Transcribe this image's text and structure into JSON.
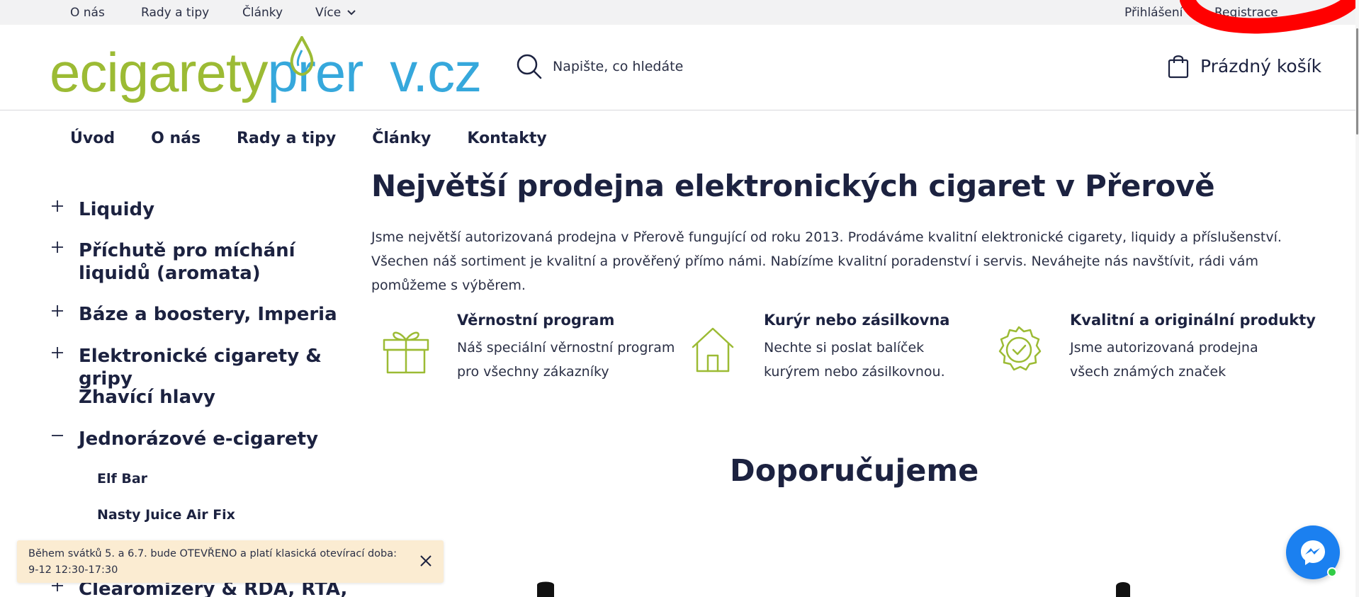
{
  "topbar": {
    "links": [
      "O nás",
      "Rady a tipy",
      "Články",
      "Více"
    ],
    "login": "Přihlášení",
    "register": "Registrace"
  },
  "header": {
    "logo_green": "ecigarety",
    "logo_pre": "prer",
    "logo_post": "v.cz",
    "search_placeholder": "Napište, co hledáte",
    "cart_label": "Prázdný košík"
  },
  "mainnav": [
    "Úvod",
    "O nás",
    "Rady a tipy",
    "Články",
    "Kontakty"
  ],
  "sidebar": {
    "categories": [
      {
        "label": "Liquidy",
        "state": "collapsed"
      },
      {
        "label": "Příchutě pro míchání liquidů (aromata)",
        "state": "collapsed"
      },
      {
        "label": "Báze a boostery, Imperia",
        "state": "collapsed"
      },
      {
        "label": "Elektronické cigarety & gripy",
        "state": "collapsed"
      },
      {
        "label": "Žhavící hlavy",
        "state": "none"
      },
      {
        "label": "Jednorázové e-cigarety",
        "state": "expanded"
      },
      {
        "label": "Clearomizery & RDA, RTA,",
        "state": "collapsed"
      }
    ],
    "subitems": [
      "Elf Bar",
      "Nasty Juice Air Fix"
    ]
  },
  "content": {
    "title": "Největší prodejna elektronických cigaret v Přerově",
    "intro": "Jsme největší autorizovaná prodejna v Přerově fungující od roku 2013. Prodáváme kvalitní elektronické cigarety, liquidy a příslušenství. Všechen náš sortiment je kvalitní a prověřený přímo námi. Nabízíme kvalitní poradenství i servis. Neváhejte nás navštívit, rádi vám pomůžeme s výběrem.",
    "features": [
      {
        "title": "Věrnostní program",
        "desc": "Náš speciální věrnostní program pro všechny zákazníky",
        "icon": "gift-icon"
      },
      {
        "title": "Kurýr nebo zásilkovna",
        "desc": "Nechte si poslat balíček kurýrem nebo zásilkovnou.",
        "icon": "house-icon"
      },
      {
        "title": "Kvalitní a originální produkty",
        "desc": "Jsme autorizovaná prodejna všech známých značek",
        "icon": "badge-check-icon"
      }
    ],
    "recommended_title": "Doporučujeme"
  },
  "notice": {
    "text": "Během svátků 5. a 6.7. bude OTEVŘENO a platí klasická otevírací doba: 9-12 12:30-17:30"
  },
  "colors": {
    "accent_green": "#9cbb34",
    "accent_blue": "#36a8dc",
    "text_dark": "#1c2240",
    "notice_bg": "#fbecd2",
    "messenger_blue": "#1b80f0"
  }
}
